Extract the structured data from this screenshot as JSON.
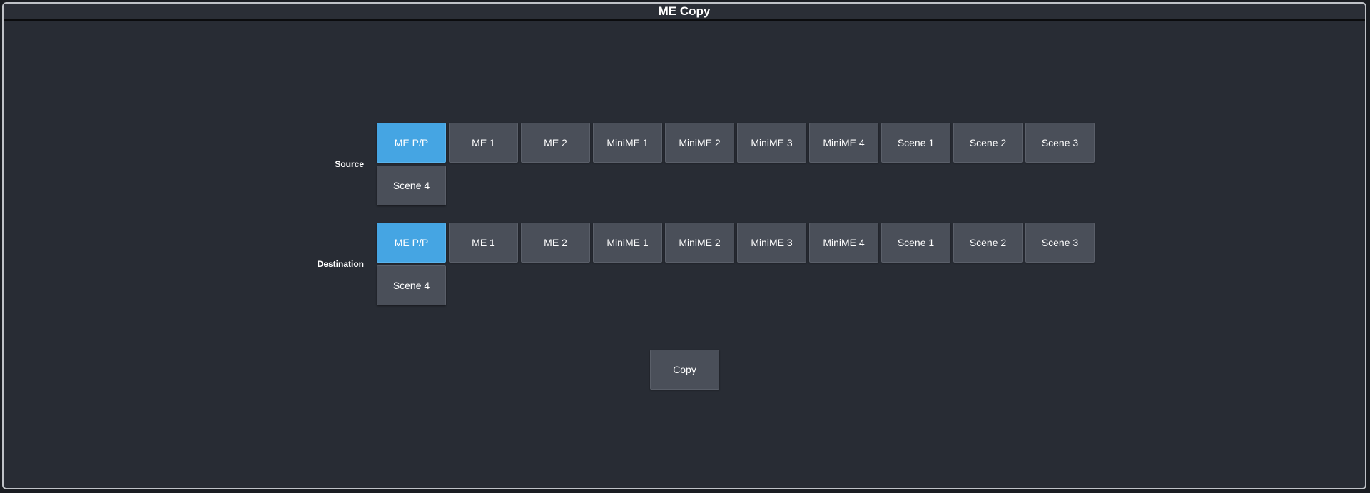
{
  "window": {
    "title": "ME Copy"
  },
  "source": {
    "label": "Source",
    "selected": "ME P/P",
    "options": [
      "ME P/P",
      "ME 1",
      "ME 2",
      "MiniME 1",
      "MiniME 2",
      "MiniME 3",
      "MiniME 4",
      "Scene 1",
      "Scene 2",
      "Scene 3",
      "Scene 4"
    ]
  },
  "destination": {
    "label": "Destination",
    "selected": "ME P/P",
    "options": [
      "ME P/P",
      "ME 1",
      "ME 2",
      "MiniME 1",
      "MiniME 2",
      "MiniME 3",
      "MiniME 4",
      "Scene 1",
      "Scene 2",
      "Scene 3",
      "Scene 4"
    ]
  },
  "actions": {
    "copy_label": "Copy"
  },
  "colors": {
    "background": "#282c34",
    "button": "#4a4f59",
    "selected": "#45a5e3",
    "text": "#ffffff"
  }
}
